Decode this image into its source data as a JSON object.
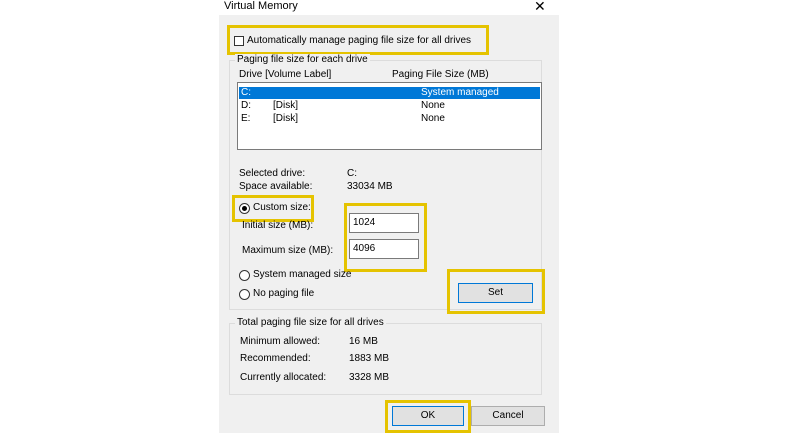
{
  "window": {
    "title": "Virtual Memory",
    "close_glyph": "✕"
  },
  "auto_manage": {
    "label": "Automatically manage paging file size for all drives",
    "checked": false
  },
  "paging_group": {
    "title": "Paging file size for each drive",
    "col_drive": "Drive  [Volume Label]",
    "col_size": "Paging File Size (MB)",
    "drives": [
      {
        "drive": "C:",
        "label": "",
        "size": "System managed",
        "selected": true
      },
      {
        "drive": "D:",
        "label": "[Disk]",
        "size": "None",
        "selected": false
      },
      {
        "drive": "E:",
        "label": "[Disk]",
        "size": "None",
        "selected": false
      }
    ],
    "selected_drive_label": "Selected drive:",
    "selected_drive_value": "C:",
    "space_available_label": "Space available:",
    "space_available_value": "33034 MB",
    "custom_size_label": "Custom size:",
    "initial_size_label": "Initial size (MB):",
    "initial_size_value": "1024",
    "maximum_size_label": "Maximum size (MB):",
    "maximum_size_value": "4096",
    "system_managed_label": "System managed size",
    "no_paging_label": "No paging file",
    "set_label": "Set",
    "selected_option": "custom"
  },
  "total_group": {
    "title": "Total paging file size for all drives",
    "minimum_label": "Minimum allowed:",
    "minimum_value": "16 MB",
    "recommended_label": "Recommended:",
    "recommended_value": "1883 MB",
    "allocated_label": "Currently allocated:",
    "allocated_value": "3328 MB"
  },
  "buttons": {
    "ok": "OK",
    "cancel": "Cancel"
  },
  "colors": {
    "highlight": "#e5c300",
    "selection": "#0078d7",
    "dialog_bg": "#f0f0f0"
  }
}
